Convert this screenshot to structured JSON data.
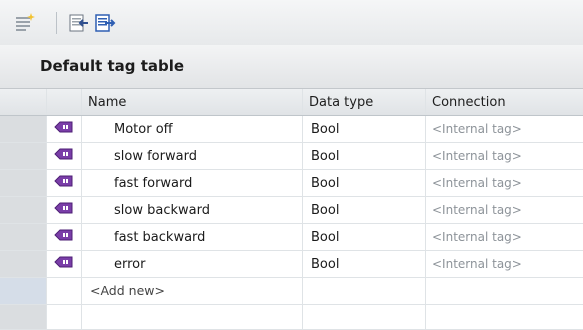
{
  "toolbar": {
    "icons": [
      "insert-row-icon",
      "import-icon",
      "export-icon"
    ]
  },
  "table_title": "Default tag table",
  "columns": {
    "name": "Name",
    "data_type": "Data type",
    "connection": "Connection"
  },
  "rows": [
    {
      "name": "Motor off",
      "data_type": "Bool",
      "connection": "<Internal tag>"
    },
    {
      "name": "slow forward",
      "data_type": "Bool",
      "connection": "<Internal tag>"
    },
    {
      "name": "fast forward",
      "data_type": "Bool",
      "connection": "<Internal tag>"
    },
    {
      "name": "slow backward",
      "data_type": "Bool",
      "connection": "<Internal tag>"
    },
    {
      "name": "fast backward",
      "data_type": "Bool",
      "connection": "<Internal tag>"
    },
    {
      "name": "error",
      "data_type": "Bool",
      "connection": "<Internal tag>"
    }
  ],
  "add_new_label": "<Add new>",
  "colors": {
    "tag_icon": "#7a3ea8",
    "toolbar_icon_blue": "#2f5fb3",
    "header_bg": "#e2e4e6",
    "grid_line": "#dfe3e6"
  }
}
